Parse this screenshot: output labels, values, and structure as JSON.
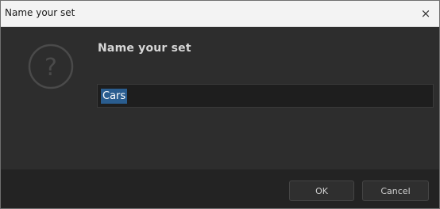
{
  "window": {
    "title": "Name your set",
    "close_glyph": "×"
  },
  "dialog": {
    "icon": "question-icon",
    "heading": "Name your set",
    "input_value": "Cars",
    "input_selected": true
  },
  "buttons": {
    "ok_label": "OK",
    "cancel_label": "Cancel"
  },
  "colors": {
    "background": "#2d2d2d",
    "footer": "#232323",
    "selection": "#2a5d8f",
    "titlebar": "#f3f3f3"
  }
}
